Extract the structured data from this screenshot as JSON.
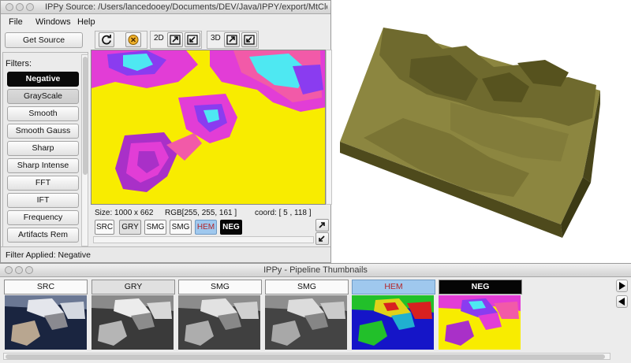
{
  "source_window": {
    "title": "IPPy Source: /Users/lancedooey/Documents/DEV/Java/IPPY/export/MtClevel...",
    "menu": [
      "File",
      "Windows",
      "Help"
    ],
    "get_source_label": "Get Source",
    "filters_label": "Filters:",
    "filters": [
      {
        "label": "Negative",
        "state": "active"
      },
      {
        "label": "GrayScale",
        "state": "pressed"
      },
      {
        "label": "Smooth",
        "state": "normal"
      },
      {
        "label": "Smooth Gauss",
        "state": "normal"
      },
      {
        "label": "Sharp",
        "state": "normal"
      },
      {
        "label": "Sharp Intense",
        "state": "normal"
      },
      {
        "label": "FFT",
        "state": "normal"
      },
      {
        "label": "IFT",
        "state": "normal"
      },
      {
        "label": "Frequency",
        "state": "normal"
      },
      {
        "label": "Artifacts Rem",
        "state": "normal"
      }
    ],
    "toolbar": {
      "refresh_icon": "refresh-icon",
      "stop_icon": "stop-icon",
      "label_2d": "2D",
      "label_3d": "3D"
    },
    "image_info": {
      "size": "Size: 1000 x 662",
      "rgb": "RGB[255, 255, 161 ]",
      "coord": "coord: [ 5 , 118 ]"
    },
    "pipeline_chips": [
      "SRC",
      "GRY",
      "SMG",
      "SMG",
      "HEM",
      "NEG"
    ],
    "status": "Filter Applied: Negative"
  },
  "thumbnail_window": {
    "title": "IPPy - Pipeline Thumbnails",
    "labels": [
      "SRC",
      "GRY",
      "SMG",
      "SMG",
      "HEM",
      "NEG"
    ]
  },
  "colors": {
    "terrain": "#6f6a2e",
    "terrain_light": "#8c8640",
    "negative_yellow": "#f8ec00",
    "negative_magenta": "#e23dd6",
    "negative_cyan": "#4ee8f2",
    "hem_blue": "#1515c8",
    "hem_green": "#22c02a"
  }
}
